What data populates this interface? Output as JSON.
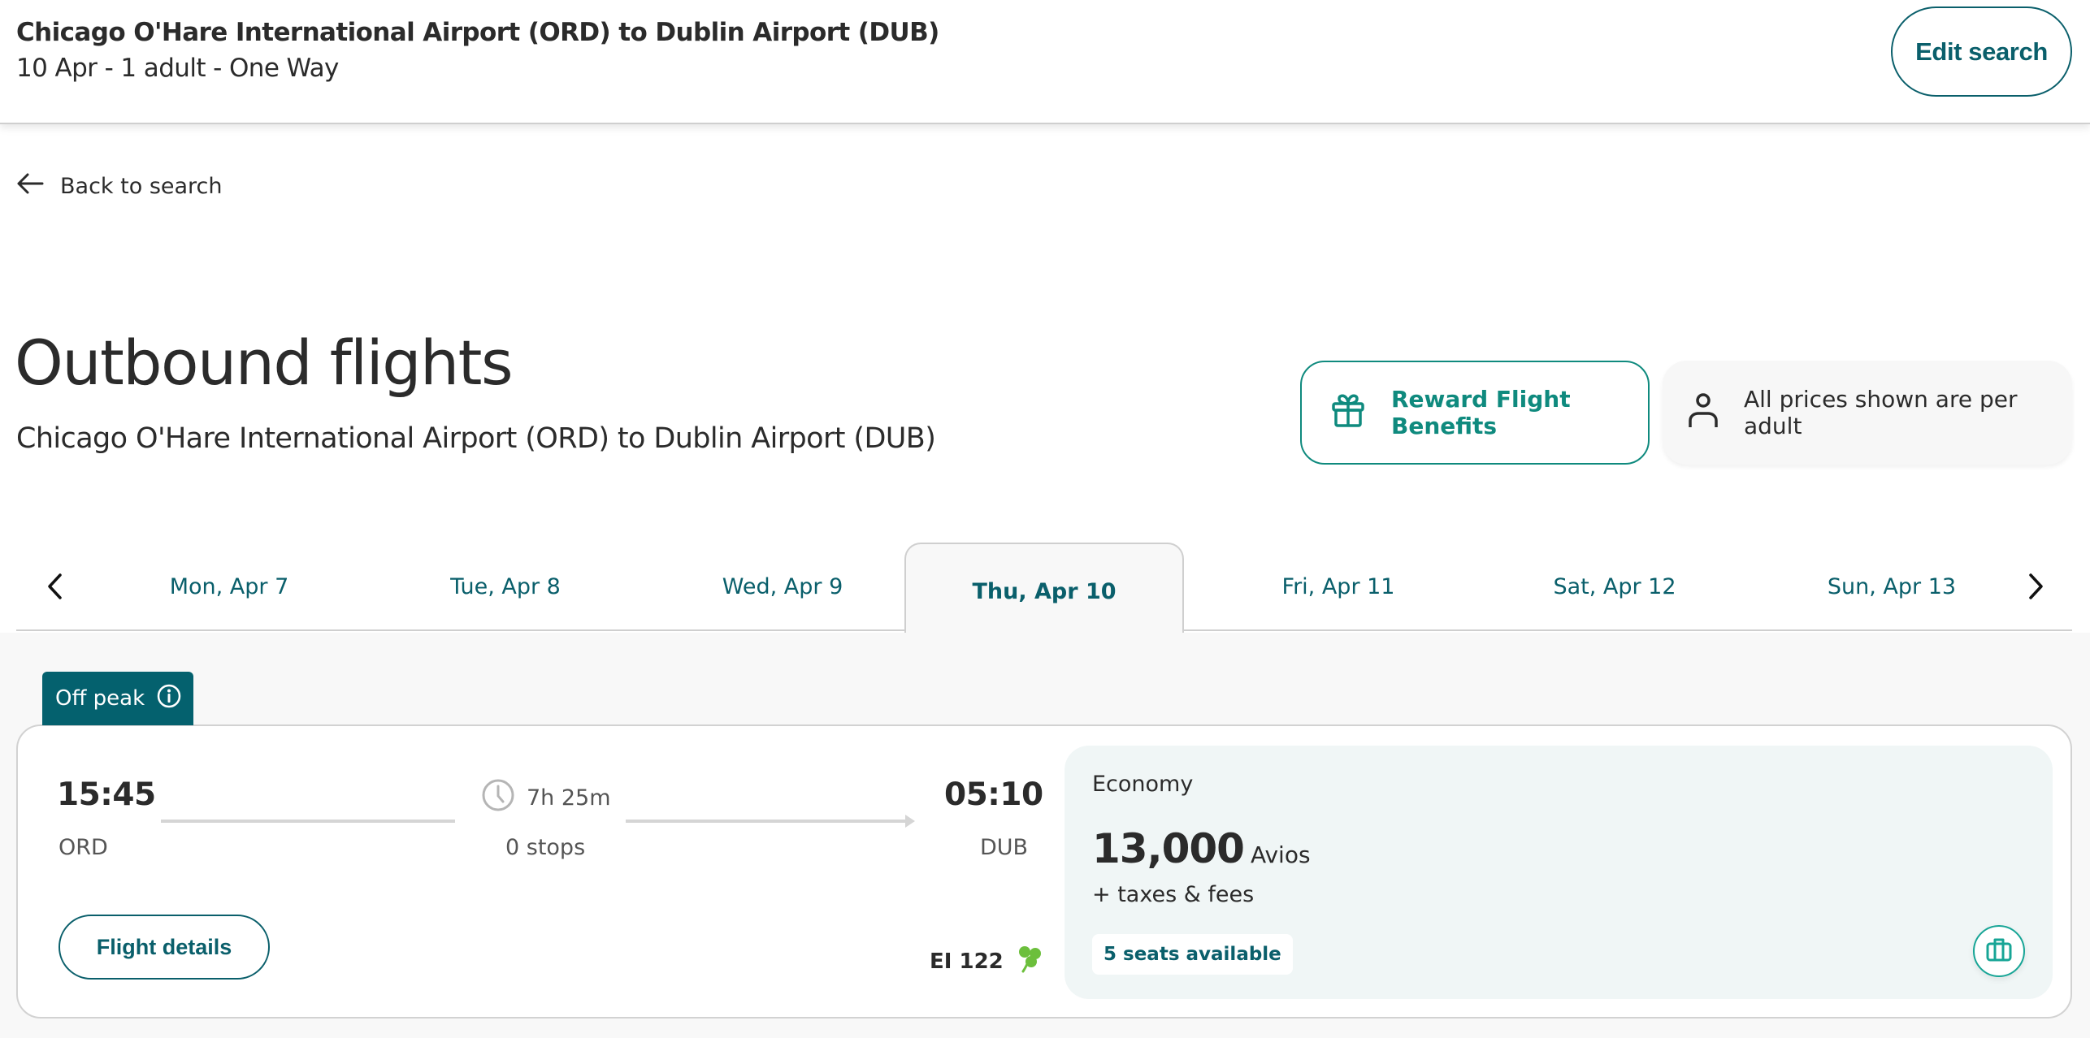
{
  "header": {
    "route": "Chicago O'Hare International Airport (ORD) to Dublin Airport (DUB)",
    "summary": "10 Apr - 1 adult - One Way",
    "edit_label": "Edit search"
  },
  "back": {
    "label": "Back to search",
    "icon": "arrow-left-icon"
  },
  "page": {
    "title": "Outbound flights",
    "subtitle": "Chicago O'Hare International Airport (ORD) to Dublin Airport (DUB)"
  },
  "info": {
    "reward_label": "Reward Flight Benefits",
    "reward_icon": "gift-icon",
    "per_adult_label": "All prices shown are per adult",
    "per_adult_icon": "person-icon"
  },
  "dates": {
    "prev_icon": "chevron-left-icon",
    "next_icon": "chevron-right-icon",
    "tabs": [
      {
        "label": "Mon, Apr 7",
        "active": false
      },
      {
        "label": "Tue, Apr 8",
        "active": false
      },
      {
        "label": "Wed, Apr 9",
        "active": false
      },
      {
        "label": "Thu, Apr 10",
        "active": true
      },
      {
        "label": "Fri, Apr 11",
        "active": false
      },
      {
        "label": "Sat, Apr 12",
        "active": false
      },
      {
        "label": "Sun, Apr 13",
        "active": false
      }
    ]
  },
  "flight": {
    "badge": "Off peak",
    "departure_time": "15:45",
    "departure_code": "ORD",
    "duration": "7h 25m",
    "stops": "0 stops",
    "arrival_time": "05:10",
    "arrival_code": "DUB",
    "details_label": "Flight details",
    "flight_number": "EI 122",
    "fare": {
      "cabin": "Economy",
      "price": "13,000",
      "unit": "Avios",
      "taxes": "+ taxes & fees",
      "seats": "5 seats available"
    }
  },
  "colors": {
    "brand": "#0a5f6b",
    "accent": "#0f8a7e",
    "badge_bg": "#04616e",
    "fare_bg": "#f0f6f6",
    "shamrock": "#6cbf3c"
  }
}
